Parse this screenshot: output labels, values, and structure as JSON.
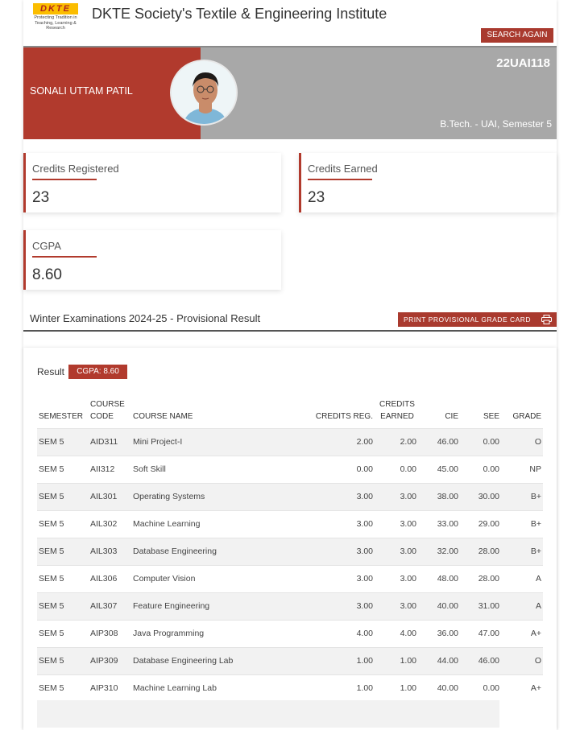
{
  "header": {
    "logo_text": "DKTE",
    "logo_tagline": "Protecting Tradition in Teaching, Learning & Research",
    "institute": "DKTE Society's Textile & Engineering Institute",
    "search_again": "SEARCH AGAIN"
  },
  "student": {
    "name": "SONALI UTTAM PATIL",
    "roll": "22UAI118",
    "program": "B.Tech. - UAI, Semester 5"
  },
  "cards": {
    "credits_registered": {
      "label": "Credits Registered",
      "value": "23"
    },
    "credits_earned": {
      "label": "Credits Earned",
      "value": "23"
    },
    "cgpa": {
      "label": "CGPA",
      "value": "8.60"
    }
  },
  "section": {
    "title": "Winter Examinations 2024-25 - Provisional Result",
    "print_button": "PRINT PROVISIONAL GRADE CARD"
  },
  "result": {
    "label": "Result",
    "cgpa_badge": "CGPA: 8.60"
  },
  "table": {
    "headers": [
      "SEMESTER",
      "COURSE CODE",
      "COURSE NAME",
      "CREDITS REG.",
      "CREDITS EARNED",
      "CIE",
      "SEE",
      "GRADE"
    ],
    "rows": [
      [
        "SEM 5",
        "AID311",
        "Mini Project-I",
        "2.00",
        "2.00",
        "46.00",
        "0.00",
        "O"
      ],
      [
        "SEM 5",
        "AII312",
        "Soft Skill",
        "0.00",
        "0.00",
        "45.00",
        "0.00",
        "NP"
      ],
      [
        "SEM 5",
        "AIL301",
        "Operating Systems",
        "3.00",
        "3.00",
        "38.00",
        "30.00",
        "B+"
      ],
      [
        "SEM 5",
        "AIL302",
        "Machine Learning",
        "3.00",
        "3.00",
        "33.00",
        "29.00",
        "B+"
      ],
      [
        "SEM 5",
        "AIL303",
        "Database Engineering",
        "3.00",
        "3.00",
        "32.00",
        "28.00",
        "B+"
      ],
      [
        "SEM 5",
        "AIL306",
        "Computer Vision",
        "3.00",
        "3.00",
        "48.00",
        "28.00",
        "A"
      ],
      [
        "SEM 5",
        "AIL307",
        "Feature Engineering",
        "3.00",
        "3.00",
        "40.00",
        "31.00",
        "A"
      ],
      [
        "SEM 5",
        "AIP308",
        "Java Programming",
        "4.00",
        "4.00",
        "36.00",
        "47.00",
        "A+"
      ],
      [
        "SEM 5",
        "AIP309",
        "Database Engineering Lab",
        "1.00",
        "1.00",
        "44.00",
        "46.00",
        "O"
      ],
      [
        "SEM 5",
        "AIP310",
        "Machine Learning Lab",
        "1.00",
        "1.00",
        "40.00",
        "0.00",
        "A+"
      ]
    ]
  },
  "colors": {
    "accent": "#b13a2d",
    "banner_grey": "#a8a8a8",
    "logo_yellow": "#fbbd00"
  },
  "icons": {
    "print": "printer-icon",
    "avatar": "student-photo"
  }
}
